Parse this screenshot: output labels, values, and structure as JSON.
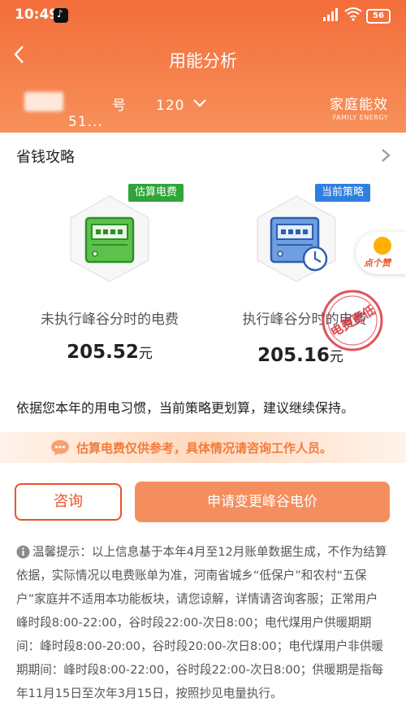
{
  "status_bar": {
    "time": "10:49",
    "battery": "56"
  },
  "header": {
    "title": "用能分析",
    "account": "　　　号　　120　　51...",
    "brand_cn": "家庭能效",
    "brand_en": "FAMILY ENERGY"
  },
  "tips_row": {
    "label": "省钱攻略"
  },
  "cards": {
    "left": {
      "tag": "估算电费",
      "caption": "未执行峰谷分时的电费",
      "amount": "205.52",
      "unit": "元"
    },
    "right": {
      "tag": "当前策略",
      "caption": "执行峰谷分时的电费",
      "amount": "205.16",
      "unit": "元"
    }
  },
  "stamp": {
    "text": "电费更低"
  },
  "float_button": {
    "label": "点个赞"
  },
  "advice": "依据您本年的用电习惯，当前策略更划算，建议继续保持。",
  "notice": "估算电费仅供参考，具体情况请咨询工作人员。",
  "buttons": {
    "consult": "咨询",
    "apply": "申请变更峰谷电价"
  },
  "warm_tip": "温馨提示：以上信息基于本年4月至12月账单数据生成，不作为结算依据，实际情况以电费账单为准，河南省城乡“低保户”和农村“五保户”家庭并不适用本功能板块，请您谅解，详情请咨询客服；正常用户 峰时段8:00-22:00，谷时段22:00-次日8:00；电代煤用户供暖期期间：峰时段8:00-20:00，谷时段20:00-次日8:00；电代煤用户非供暖期期间：峰时段8:00-22:00，谷时段22:00-次日8:00；供暖期是指每年11月15日至次年3月15日，按照抄见电量执行。",
  "colors": {
    "header": "#f36d3a",
    "accent": "#e8542a",
    "green_tag": "#2fa53a",
    "blue_tag": "#2f7ee0"
  }
}
